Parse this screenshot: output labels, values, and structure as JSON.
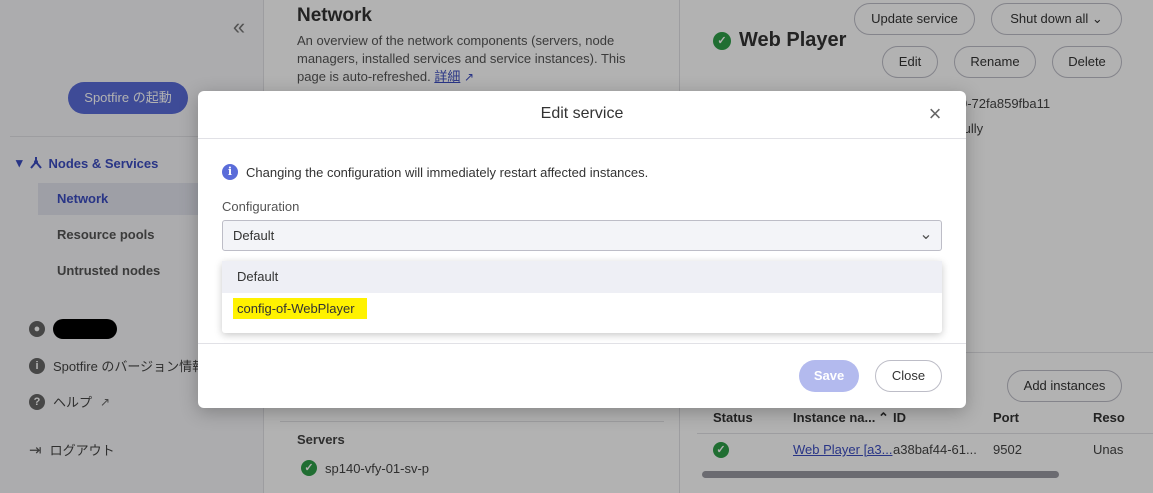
{
  "sidebar": {
    "collapse_glyph": "«",
    "launch_label": "Spotfire の起動",
    "section_label": "Nodes & Services",
    "items": [
      {
        "label": "Network"
      },
      {
        "label": "Resource pools"
      },
      {
        "label": "Untrusted nodes"
      }
    ],
    "version_label": "Spotfire のバージョン情報",
    "help_label": "ヘルプ",
    "logout_label": "ログアウト"
  },
  "network": {
    "title": "Network",
    "description": "An overview of the network components (servers, node managers, installed services and service instances). This page is auto-refreshed.",
    "details_link": "詳細",
    "servers_heading": "Servers",
    "server_name": "sp140-vfy-01-sv-p"
  },
  "service": {
    "title": "Web Player",
    "update_label": "Update service",
    "shutdown_label": "Shut down all",
    "edit_label": "Edit",
    "rename_label": "Rename",
    "delete_label": "Delete",
    "id_fragment": "0-72fa859fba11",
    "state_fragment": "fully",
    "add_instances_label": "Add instances",
    "table": {
      "headers": [
        "Status",
        "Instance na...",
        "ID",
        "Port",
        "Reso"
      ],
      "row": {
        "instance": "Web Player [a3...",
        "id": "a38baf44-61...",
        "port": "9502",
        "resource": "Unas"
      }
    }
  },
  "modal": {
    "title": "Edit service",
    "info_text": "Changing the configuration will immediately restart affected instances.",
    "config_label": "Configuration",
    "selected_value": "Default",
    "options": [
      "Default",
      "config-of-WebPlayer"
    ],
    "save_label": "Save",
    "close_label": "Close"
  },
  "colors": {
    "accent": "#5a6cd9",
    "success": "#2e9e48",
    "highlight": "#fff200"
  }
}
